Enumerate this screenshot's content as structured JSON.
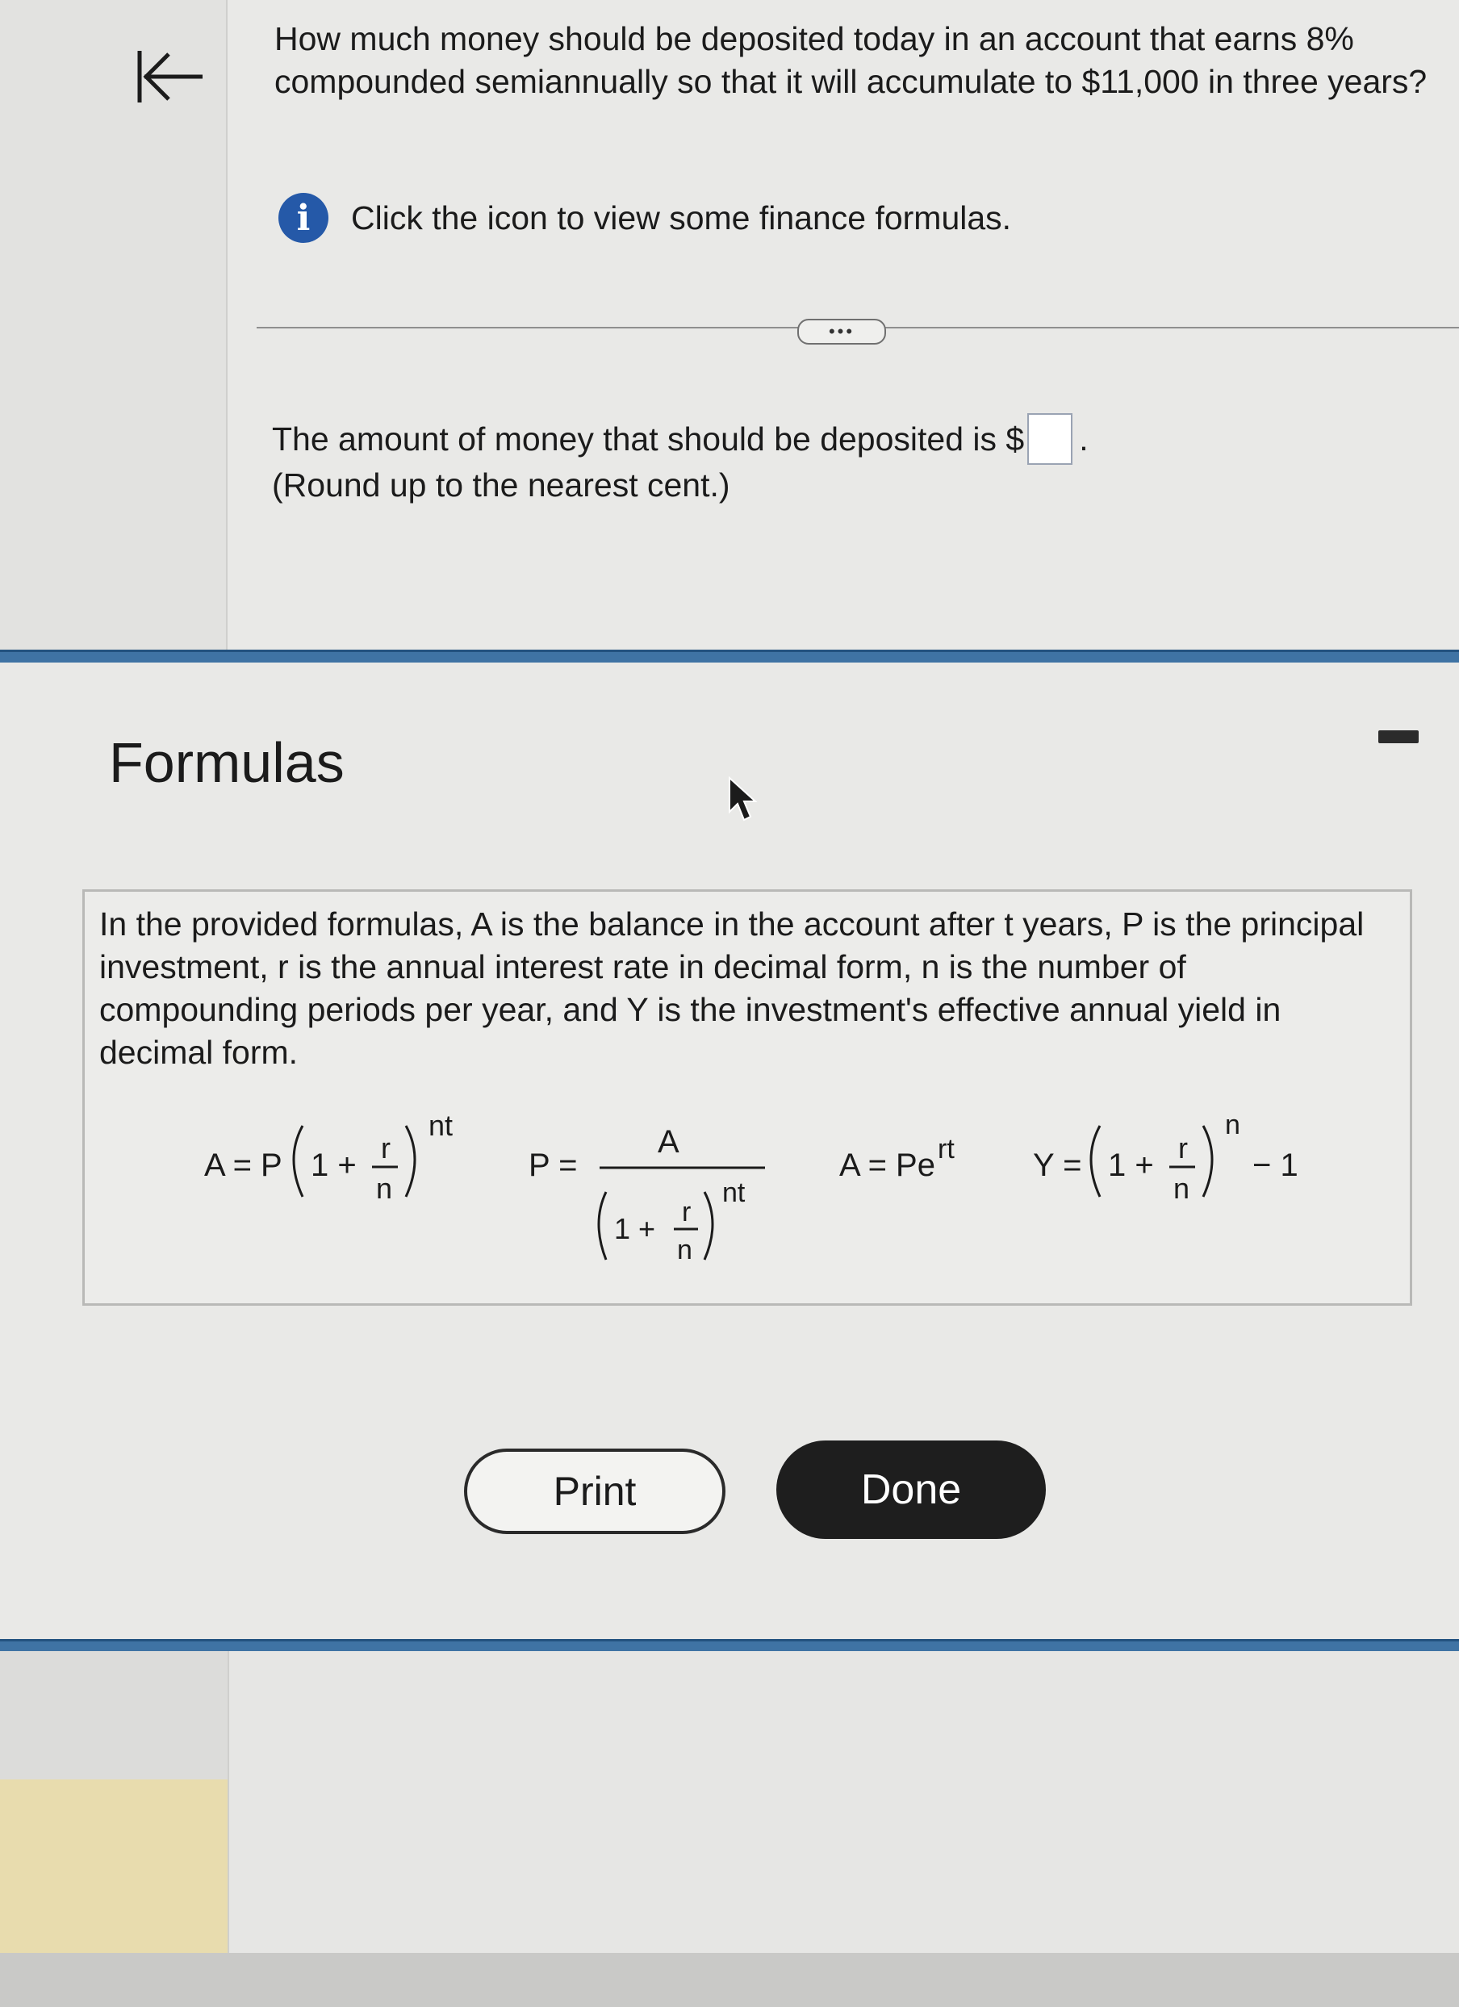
{
  "question": {
    "text": "How much money should be deposited today in an account that earns 8% compounded semiannually so that it will accumulate to $11,000 in three years?",
    "info_icon": "info-icon",
    "info_text": "Click the icon to view some finance formulas.",
    "more_label": "•••",
    "answer_prefix": "The amount of money that should be deposited is $",
    "answer_value": "",
    "answer_suffix": ".",
    "note": "(Round up to the nearest cent.)"
  },
  "dialog": {
    "title": "Formulas",
    "description": "In the provided formulas, A is the balance in the account after t years, P is the principal investment, r is the annual interest rate in decimal form, n is the number of compounding periods per year, and Y is the investment's effective annual yield in decimal form.",
    "formulas": {
      "f1": {
        "lhs": "A = P",
        "one_plus": "1 +",
        "num": "r",
        "den": "n",
        "exp": "nt"
      },
      "f2": {
        "lhs": "P =",
        "num": "A",
        "one_plus": "1 +",
        "inner_num": "r",
        "inner_den": "n",
        "exp": "nt"
      },
      "f3": {
        "lhs": "A = Pe",
        "exp": "rt"
      },
      "f4": {
        "lhs": "Y =",
        "one_plus": "1 +",
        "num": "r",
        "den": "n",
        "exp": "n",
        "tail": "− 1"
      }
    },
    "print_label": "Print",
    "done_label": "Done"
  },
  "colors": {
    "info_blue": "#2559a8",
    "separator_blue": "#3f73a4",
    "done_bg": "#1e1e1e"
  }
}
